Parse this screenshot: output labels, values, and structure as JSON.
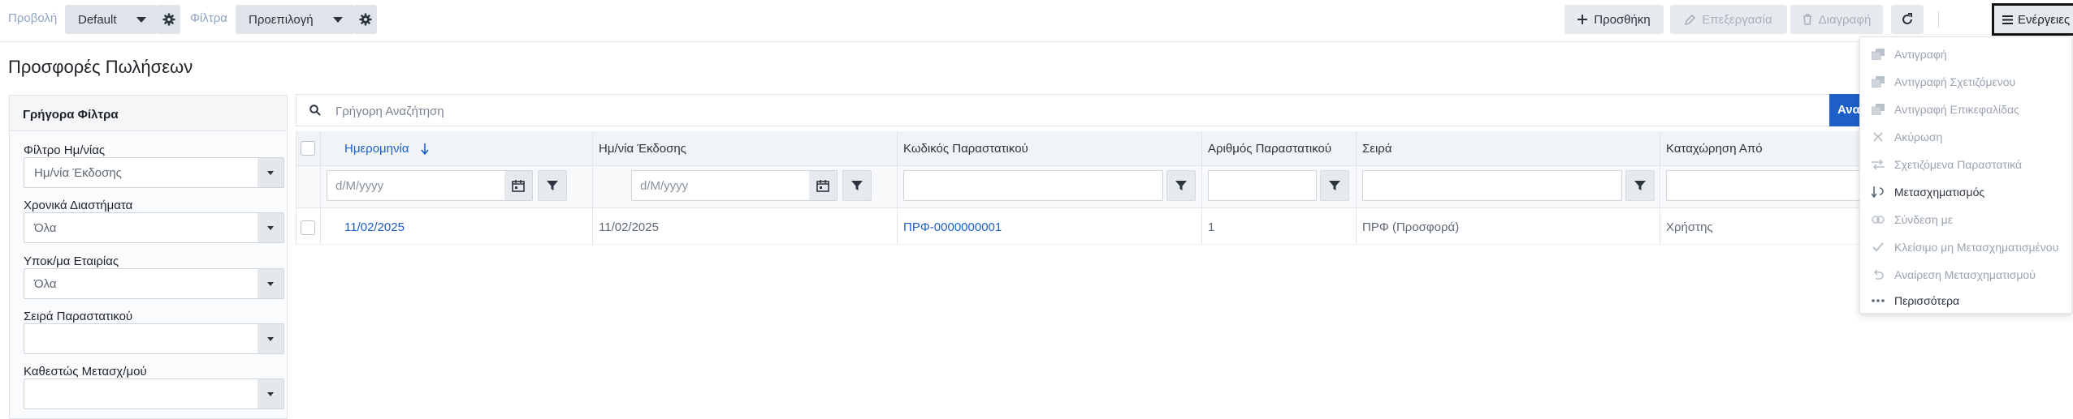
{
  "toolbar": {
    "view_label": "Προβολή",
    "view_value": "Default",
    "filters_label": "Φίλτρα",
    "filters_value": "Προεπιλογή",
    "add_label": "Προσθήκη",
    "edit_label": "Επεξεργασία",
    "delete_label": "Διαγραφή",
    "actions_label": "Ενέργειες"
  },
  "page": {
    "title": "Προσφορές Πωλήσεων"
  },
  "quick_filters": {
    "title": "Γρήγορα Φίλτρα",
    "fields": [
      {
        "label": "Φίλτρο Ημ/νίας",
        "value": "Ημ/νία Έκδοσης"
      },
      {
        "label": "Χρονικά Διαστήματα",
        "value": "Όλα"
      },
      {
        "label": "Υποκ/μα Εταιρίας",
        "value": "Όλα"
      },
      {
        "label": "Σειρά Παραστατικού",
        "value": ""
      },
      {
        "label": "Καθεστώς Μετασχ/μού",
        "value": ""
      }
    ]
  },
  "search": {
    "placeholder": "Γρήγορη Αναζήτηση",
    "button_label": "Αναζήτηση"
  },
  "grid": {
    "columns": [
      "Ημερομηνία",
      "Ημ/νία Έκδοσης",
      "Κωδικός Παραστατικού",
      "Αριθμός Παραστατικού",
      "Σειρά",
      "Καταχώρηση Από"
    ],
    "date_placeholder": "d/M/yyyy",
    "rows": [
      {
        "date": "11/02/2025",
        "issue_date": "11/02/2025",
        "code": "ΠΡΦ-0000000001",
        "number": "1",
        "series": "ΠΡΦ (Προσφορά)",
        "created_by": "Χρήστης"
      }
    ]
  },
  "actions_menu": {
    "items": [
      {
        "label": "Αντιγραφή",
        "icon": "copy-icon",
        "enabled": false
      },
      {
        "label": "Αντιγραφή Σχετιζόμενου",
        "icon": "copy-related-icon",
        "enabled": false
      },
      {
        "label": "Αντιγραφή Επικεφαλίδας",
        "icon": "copy-header-icon",
        "enabled": false
      },
      {
        "label": "Ακύρωση",
        "icon": "cancel-icon",
        "enabled": false
      },
      {
        "label": "Σχετιζόμενα Παραστατικά",
        "icon": "related-docs-icon",
        "enabled": false
      },
      {
        "label": "Μετασχηματισμός",
        "icon": "transform-icon",
        "enabled": true
      },
      {
        "label": "Σύνδεση με",
        "icon": "link-icon",
        "enabled": false
      },
      {
        "label": "Κλείσιμο μη Μετασχηματισμένου",
        "icon": "check-icon",
        "enabled": false
      },
      {
        "label": "Αναίρεση Μετασχηματισμού",
        "icon": "undo-icon",
        "enabled": false
      },
      {
        "label": "Περισσότερα",
        "icon": "more-icon",
        "enabled": true
      }
    ]
  },
  "colors": {
    "accent": "#1e5fc7",
    "toolbar_button": "#e6eaef",
    "highlight_border": "#111111"
  }
}
